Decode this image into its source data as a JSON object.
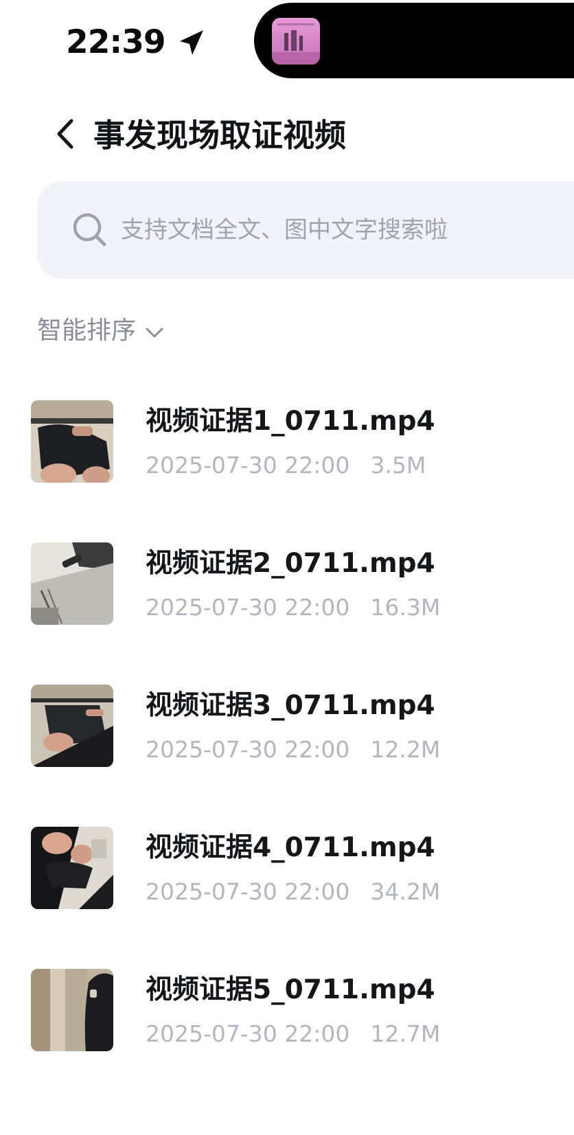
{
  "status_bar": {
    "time": "22:39",
    "location_icon": "location-arrow-icon",
    "now_playing_icon": "album-artwork"
  },
  "header": {
    "back_icon": "chevron-left-icon",
    "title": "事发现场取证视频"
  },
  "search": {
    "icon": "search-icon",
    "placeholder": "支持文档全文、图中文字搜索啦",
    "value": ""
  },
  "sort": {
    "label": "智能排序",
    "icon": "chevron-down-icon"
  },
  "files": [
    {
      "name": "视频证据1_0711.mp4",
      "date": "2025-07-30 22:00",
      "size": "3.5M"
    },
    {
      "name": "视频证据2_0711.mp4",
      "date": "2025-07-30 22:00",
      "size": "16.3M"
    },
    {
      "name": "视频证据3_0711.mp4",
      "date": "2025-07-30 22:00",
      "size": "12.2M"
    },
    {
      "name": "视频证据4_0711.mp4",
      "date": "2025-07-30 22:00",
      "size": "34.2M"
    },
    {
      "name": "视频证据5_0711.mp4",
      "date": "2025-07-30 22:00",
      "size": "12.7M"
    }
  ],
  "colors": {
    "background": "#ffffff",
    "title_text": "#121317",
    "secondary_text": "#8a8d96",
    "meta_text": "#b3b6be",
    "search_background": "#f2f3f8"
  }
}
